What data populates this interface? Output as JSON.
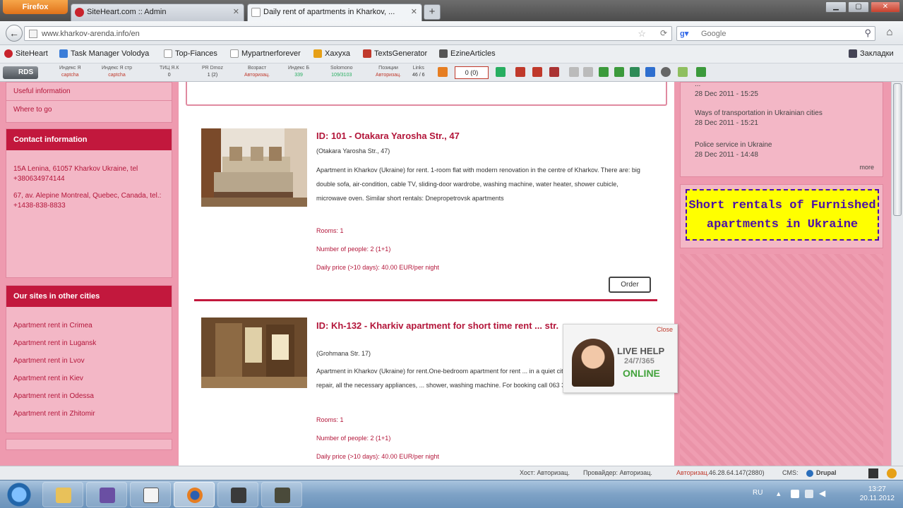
{
  "browser": {
    "menu_button": "Firefox",
    "tabs": [
      {
        "title": "SiteHeart.com :: Admin"
      },
      {
        "title": "Daily rent of apartments in Kharkov, ..."
      }
    ],
    "url": "www.kharkov-arenda.info/en",
    "search_placeholder": "Google",
    "bookmarks": [
      "SiteHeart",
      "Task Manager Volodya",
      "Top-Fiances",
      "Mypartnerforever",
      "Хахуха",
      "TextsGenerator",
      "EzineArticles"
    ],
    "bookmarks_right": "Закладки",
    "seo_rds": "RDS",
    "seo_cells": [
      {
        "label": "Индекс Я",
        "value": "captcha"
      },
      {
        "label": "Индекс Я стр",
        "value": "captcha"
      },
      {
        "label": "ТИЦ Я.К",
        "value": "0"
      },
      {
        "label": "PR Dmoz",
        "value": "1 (2)"
      },
      {
        "label": "Возраст",
        "value": "Авторизац."
      },
      {
        "label": "Индекс Б",
        "value": "339"
      },
      {
        "label": "Solomono",
        "value": "109/3103"
      },
      {
        "label": "Позиции",
        "value": "Авторизац."
      },
      {
        "label": "Links",
        "value": "46 / 6"
      }
    ],
    "seo_counter": "0 (0)"
  },
  "sidebar_left": {
    "links_top": [
      "Useful information",
      "Where to go"
    ],
    "contact_title": "Contact information",
    "contact_lines": [
      "15A Lenina, 61057 Kharkov Ukraine, tel +380634974144",
      "67, av. Alepine Montreal, Quebec, Canada, tel.: +1438-838-8833"
    ],
    "cities_title": "Our sites in other cities",
    "cities": [
      "Apartment rent in Crimea",
      "Apartment rent in Lugansk",
      "Apartment rent in Lvov",
      "Apartment rent in Kiev",
      "Apartment rent in Odessa",
      "Apartment rent in Zhitomir"
    ]
  },
  "listings": [
    {
      "title": "ID: 101 - Otakara Yarosha Str., 47",
      "address": "(Otakara Yarosha Str., 47)",
      "description": "Apartment in Kharkov (Ukraine) for rent. 1-room flat with modern renovation in the centre of Kharkov. There are: big double sofa, air-condition, cable TV, sliding-door wardrobe, washing machine, water heater, shower cubicle, microwave oven. Similar short rentals: Dnepropetrovsk apartments",
      "rooms": "Rooms: 1",
      "people": "Number of people: 2 (1+1)",
      "price": "Daily price (>10 days): 40.00 EUR/per night",
      "order": "Order"
    },
    {
      "title": "ID: Kh-132 - Kharkiv apartment for short time rent ... str.",
      "address": "(Grohmana Str. 17)",
      "description": "Apartment in Kharkov (Ukraine) for rent.One-bedroom apartment for rent ... in a quiet city center! The renovated repair, all the necessary appliances, ... shower, washing machine. For booking call 063 3044554",
      "rooms": "Rooms: 1",
      "people": "Number of people: 2 (1+1)",
      "price": "Daily price (>10 days): 40.00 EUR/per night"
    }
  ],
  "sidebar_right": {
    "news": [
      {
        "title": "...",
        "date": "28 Dec 2011 - 15:25"
      },
      {
        "title": "Ways of transportation in Ukrainian cities",
        "date": "28 Dec 2011 - 15:21"
      },
      {
        "title": "Police service in Ukraine",
        "date": "28 Dec 2011 - 14:48"
      }
    ],
    "more": "more",
    "banner": "Short rentals of Furnished apartments in Ukraine"
  },
  "livehelp": {
    "close": "Close",
    "line1": "LIVE HELP",
    "line2": "24/7/365",
    "line3": "ONLINE"
  },
  "statusbar": {
    "host": "Хост: Авторизац.",
    "provider": "Провайдер: Авторизац.",
    "auth": "Авторизац.",
    "ip": "46.28.64.147(2880)",
    "cms": "CMS:",
    "cms_name": "Drupal"
  },
  "taskbar": {
    "lang": "RU",
    "time": "13:27",
    "date": "20.11.2012"
  },
  "colors": {
    "brand_red": "#c2183d",
    "pink_bg": "#ee9aaf",
    "banner_yellow": "#ffff00",
    "banner_text": "#4b0eaa"
  }
}
